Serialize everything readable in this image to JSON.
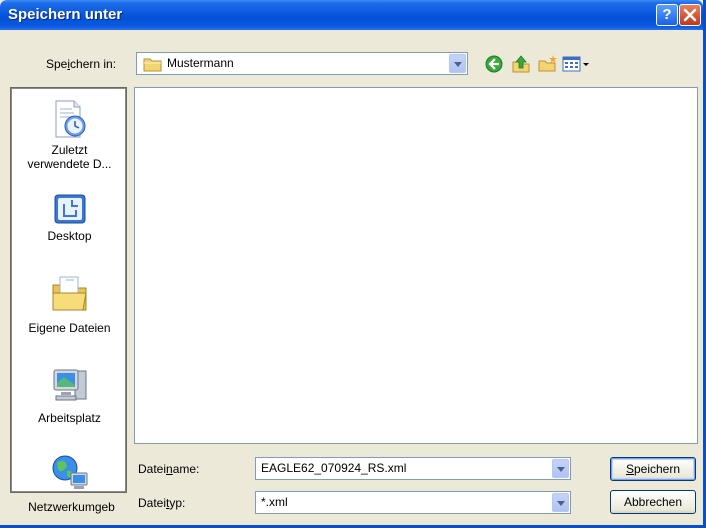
{
  "window": {
    "title": "Speichern unter",
    "help_symbol": "?"
  },
  "savein": {
    "label_pre": "Spe",
    "label_accel": "i",
    "label_post": "chern in:",
    "value": "Mustermann"
  },
  "places": [
    {
      "label_line1": "Zuletzt",
      "label_line2": "verwendete D...",
      "icon": "recent-documents-icon"
    },
    {
      "label_line1": "Desktop",
      "label_line2": "",
      "icon": "desktop-icon"
    },
    {
      "label_line1": "Eigene Dateien",
      "label_line2": "",
      "icon": "my-documents-icon"
    },
    {
      "label_line1": "Arbeitsplatz",
      "label_line2": "",
      "icon": "my-computer-icon"
    },
    {
      "label_line1": "Netzwerkumgeb",
      "label_line2": "",
      "icon": "network-places-icon"
    }
  ],
  "filename": {
    "label_pre": "Datei",
    "label_accel": "n",
    "label_post": "ame:",
    "value": "EAGLE62_070924_RS.xml"
  },
  "filetype": {
    "label_pre": "Datei",
    "label_accel": "t",
    "label_post": "yp:",
    "value": "*.xml"
  },
  "buttons": {
    "save_accel": "S",
    "save_rest": "peichern",
    "cancel": "Abbrechen"
  },
  "colors": {
    "titlebar": "#0a58e0",
    "dialog_bg": "#ece9d8",
    "field_border": "#7f9db9"
  }
}
